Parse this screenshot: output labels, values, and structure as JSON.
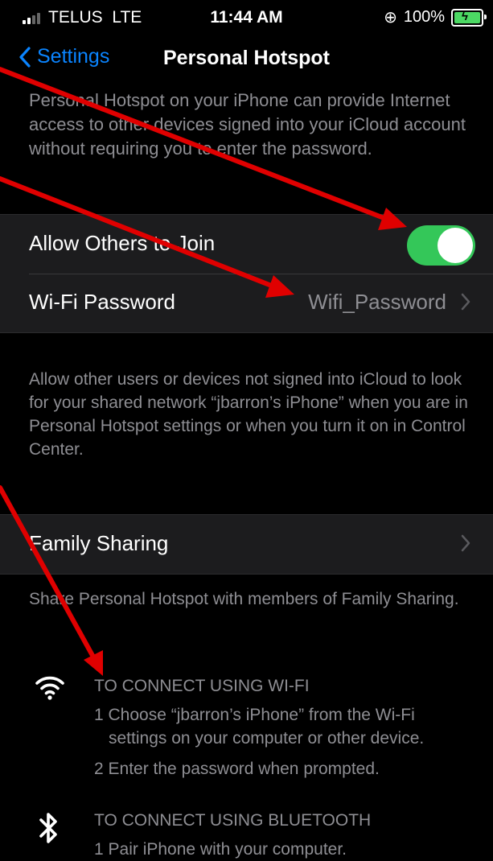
{
  "status": {
    "carrier": "TELUS",
    "network": "LTE",
    "time": "11:44 AM",
    "battery": "100%"
  },
  "nav": {
    "back_label": "Settings",
    "title": "Personal Hotspot"
  },
  "intro": "Personal Hotspot on your iPhone can provide Internet access to other devices signed into your iCloud account without requiring you to enter the password.",
  "group1": {
    "allow_label": "Allow Others to Join",
    "allow_on": true,
    "wifi_label": "Wi-Fi Password",
    "wifi_value": "Wifi_Password"
  },
  "footer1": "Allow other users or devices not signed into iCloud to look for your shared network “jbarron’s iPhone” when you are in Personal Hotspot settings or when you turn it on in Control Center.",
  "group2": {
    "family_label": "Family Sharing"
  },
  "footer2": "Share Personal Hotspot with members of Family Sharing.",
  "wifi_connect": {
    "title": "TO CONNECT USING WI-FI",
    "step1_line1": "1 Choose “jbarron’s iPhone” from the Wi-Fi",
    "step1_line2": "settings on your computer or other device.",
    "step2": "2 Enter the password when prompted."
  },
  "bt_connect": {
    "title": "TO CONNECT USING BLUETOOTH",
    "step1": "1 Pair iPhone with your computer."
  },
  "colors": {
    "accent": "#0a84ff",
    "toggle_on": "#34c759",
    "annotation": "#e00000"
  }
}
